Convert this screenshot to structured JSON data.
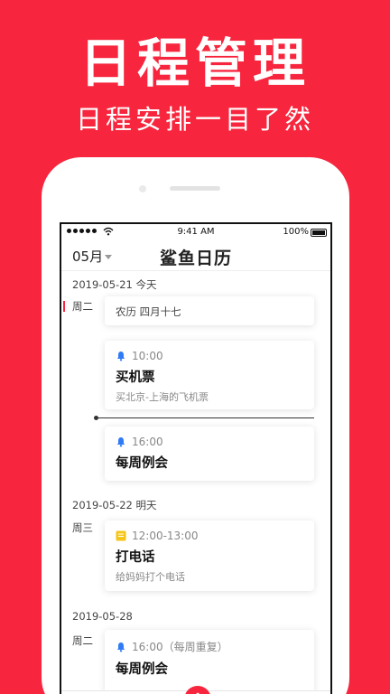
{
  "promo": {
    "title": "日程管理",
    "subtitle": "日程安排一目了然"
  },
  "status_bar": {
    "time": "9:41 AM",
    "battery": "100%"
  },
  "header": {
    "month": "05月",
    "app_name": "鲨鱼日历"
  },
  "days": [
    {
      "date": "2019-05-21 今天",
      "weekday": "周二",
      "lunar": "农历 四月十七",
      "events": [
        {
          "time": "10:00",
          "title": "买机票",
          "desc": "买北京-上海的飞机票"
        },
        {
          "time": "16:00",
          "title": "每周例会",
          "desc": ""
        }
      ]
    },
    {
      "date": "2019-05-22 明天",
      "weekday": "周三",
      "events": [
        {
          "time": "12:00-13:00",
          "title": "打电话",
          "desc": "给妈妈打个电话"
        }
      ]
    },
    {
      "date": "2019-05-28",
      "weekday": "周二",
      "events": [
        {
          "time": "16:00（每周重复）",
          "title": "每周例会",
          "desc": ""
        }
      ]
    }
  ],
  "colors": {
    "brand": "#f7253d",
    "bell": "#2f7bf5",
    "note": "#f5c518"
  },
  "tabbar": {
    "icons": [
      "calendar-icon",
      "split-view-icon",
      "add-icon",
      "schedule-icon",
      "profile-icon"
    ],
    "add_label": "+"
  }
}
